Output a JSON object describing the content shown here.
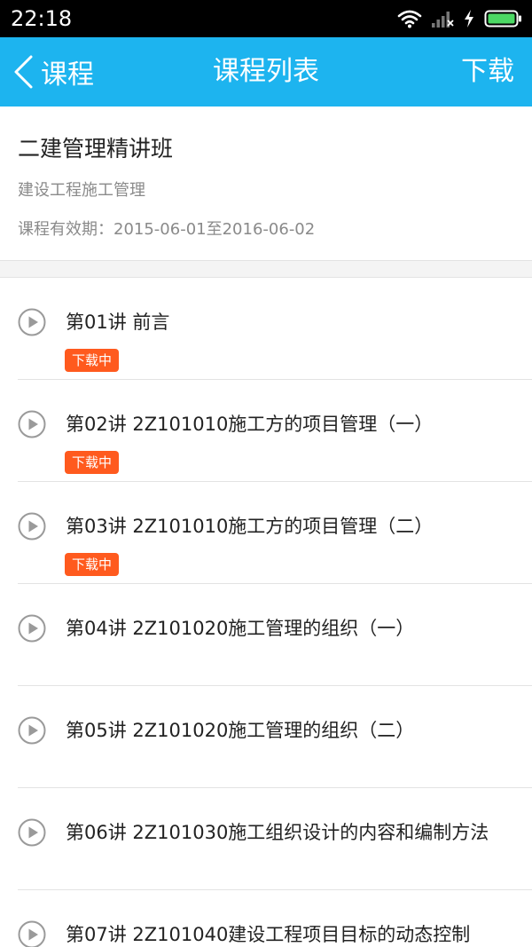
{
  "status_bar": {
    "time": "22:18",
    "icons": [
      "wifi-icon",
      "cell-signal-icon",
      "charging-icon",
      "battery-icon"
    ]
  },
  "nav": {
    "back_label": "课程",
    "title": "课程列表",
    "download_label": "下载"
  },
  "course": {
    "title": "二建管理精讲班",
    "subject": "建设工程施工管理",
    "validity": "课程有效期：2015-06-01至2016-06-02"
  },
  "lessons": [
    {
      "title": "第01讲 前言",
      "badge": "下载中"
    },
    {
      "title": "第02讲 2Z101010施工方的项目管理（一）",
      "badge": "下载中"
    },
    {
      "title": "第03讲 2Z101010施工方的项目管理（二）",
      "badge": "下载中"
    },
    {
      "title": "第04讲 2Z101020施工管理的组织（一）"
    },
    {
      "title": "第05讲 2Z101020施工管理的组织（二）"
    },
    {
      "title": "第06讲 2Z101030施工组织设计的内容和编制方法"
    },
    {
      "title": "第07讲 2Z101040建设工程项目目标的动态控制"
    }
  ],
  "colors": {
    "nav_bg": "#1db4ef",
    "badge_bg": "#ff5a1e",
    "battery_green": "#4cd964"
  }
}
